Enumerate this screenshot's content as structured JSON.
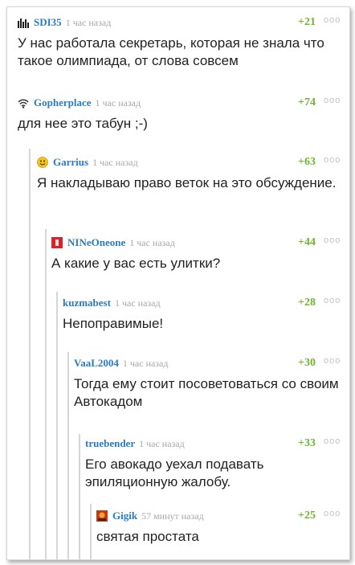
{
  "colors": {
    "author": "#2b7bc2",
    "rating": "#6eb530",
    "time": "#a8a8a8",
    "text": "#222222",
    "thread_line": "#d6d6d6"
  },
  "comments": [
    {
      "author": "SDI35",
      "avatar_icon": "equalizer-avatar-icon",
      "time": "1 час назад",
      "rating": "+21",
      "menu": "ooo",
      "text": "У нас работала секретарь, которая не знала что такое олимпиада, от слова совсем"
    },
    {
      "author": "Gopherplace",
      "avatar_icon": "wifi-avatar-icon",
      "time": "1 час назад",
      "rating": "+74",
      "menu": "ooo",
      "text": "для нее это табун ;-)"
    },
    {
      "author": "Garrius",
      "avatar_icon": "smiley-avatar-icon",
      "time": "1 час назад",
      "rating": "+63",
      "menu": "ooo",
      "text": "Я накладываю право веток на это обсуждение."
    },
    {
      "author": "NINeOneone",
      "avatar_icon": "red-square-avatar-icon",
      "time": "1 час назад",
      "rating": "+44",
      "menu": "ooo",
      "text": "А какие у вас есть улитки?"
    },
    {
      "author": "kuzmabest",
      "time": "1 час назад",
      "rating": "+28",
      "menu": "ooo",
      "text": "Непоправимые!"
    },
    {
      "author": "VaaL2004",
      "time": "1 час назад",
      "rating": "+30",
      "menu": "ooo",
      "text": "Тогда ему стоит посоветоваться со своим Автокадом"
    },
    {
      "author": "truebender",
      "time": "1 час назад",
      "rating": "+33",
      "menu": "ooo",
      "text": "Его авокадо уехал подавать эпиляционную жалобу."
    },
    {
      "author": "Gigik",
      "avatar_icon": "picture-avatar-icon",
      "time": "57 минут назад",
      "rating": "+25",
      "menu": "ooo",
      "text": "святая простата"
    }
  ]
}
